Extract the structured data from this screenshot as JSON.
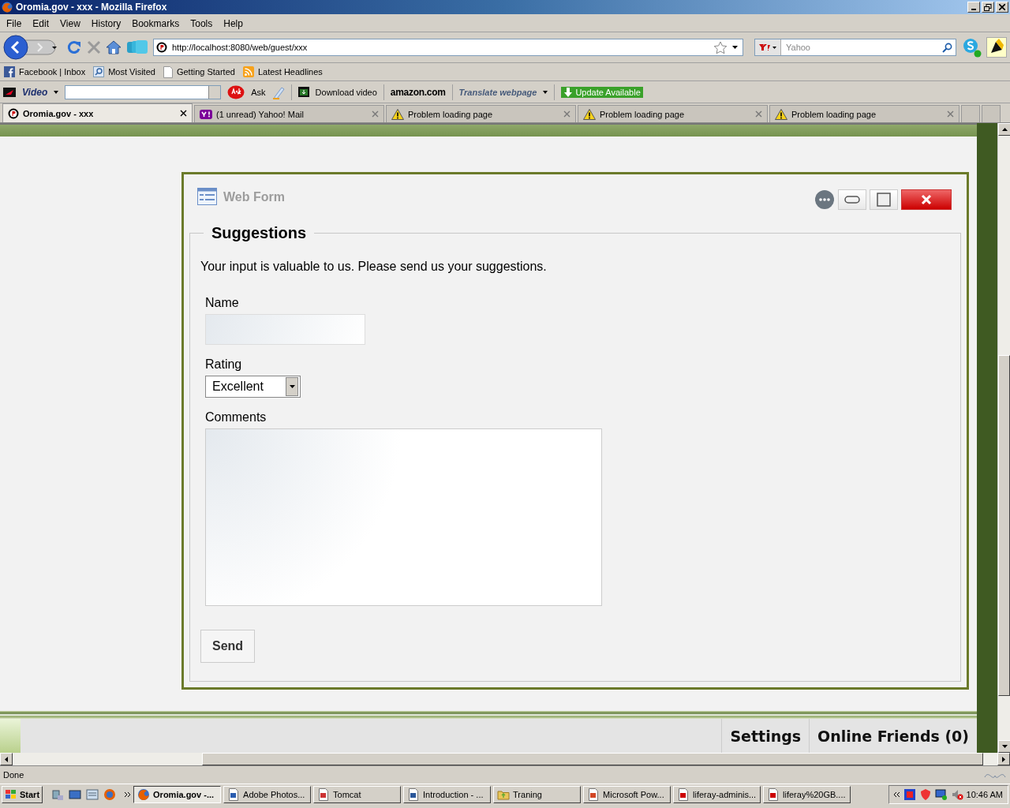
{
  "window": {
    "title": "Oromia.gov - xxx - Mozilla Firefox"
  },
  "menu": [
    "File",
    "Edit",
    "View",
    "History",
    "Bookmarks",
    "Tools",
    "Help"
  ],
  "navigation": {
    "url": "http://localhost:8080/web/guest/xxx",
    "search_placeholder": "Yahoo"
  },
  "bookmarks": [
    {
      "label": "Facebook | Inbox",
      "kind": "facebook"
    },
    {
      "label": "Most Visited",
      "kind": "search"
    },
    {
      "label": "Getting Started",
      "kind": "page"
    },
    {
      "label": "Latest Headlines",
      "kind": "feed"
    }
  ],
  "toolbar": {
    "video": "Video",
    "ask": "Ask",
    "download": "Download video",
    "amazon": "amazon.com",
    "translate": "Translate webpage",
    "update": "Update Available"
  },
  "tabs": [
    {
      "title": "Oromia.gov - xxx",
      "kind": "site",
      "selected": true
    },
    {
      "title": "(1 unread) Yahoo! Mail",
      "kind": "yahoo",
      "selected": false
    },
    {
      "title": "Problem loading page",
      "kind": "warning",
      "selected": false
    },
    {
      "title": "Problem loading page",
      "kind": "warning",
      "selected": false
    },
    {
      "title": "Problem loading page",
      "kind": "warning",
      "selected": false
    }
  ],
  "portlet": {
    "title": "Web Form",
    "legend": "Suggestions",
    "intro": "Your input is valuable to us. Please send us your suggestions.",
    "name_label": "Name",
    "rating_label": "Rating",
    "rating_value": "Excellent",
    "comments_label": "Comments",
    "send": "Send"
  },
  "dock": [
    "Settings",
    "Online Friends (0)"
  ],
  "status": "Done",
  "taskbar": {
    "start": "Start",
    "clock": "10:46 AM",
    "items": [
      {
        "label": "Oromia.gov -...",
        "kind": "firefox",
        "selected": true
      },
      {
        "label": "Adobe Photos...",
        "kind": "feather",
        "selected": false
      },
      {
        "label": "Tomcat",
        "kind": "java",
        "selected": false
      },
      {
        "label": "Introduction - ...",
        "kind": "word",
        "selected": false
      },
      {
        "label": "Traning",
        "kind": "folder",
        "selected": false
      },
      {
        "label": "Microsoft Pow...",
        "kind": "ppt",
        "selected": false
      },
      {
        "label": "liferay-adminis...",
        "kind": "pdf",
        "selected": false
      },
      {
        "label": "liferay%20GB....",
        "kind": "pdf",
        "selected": false
      }
    ]
  }
}
